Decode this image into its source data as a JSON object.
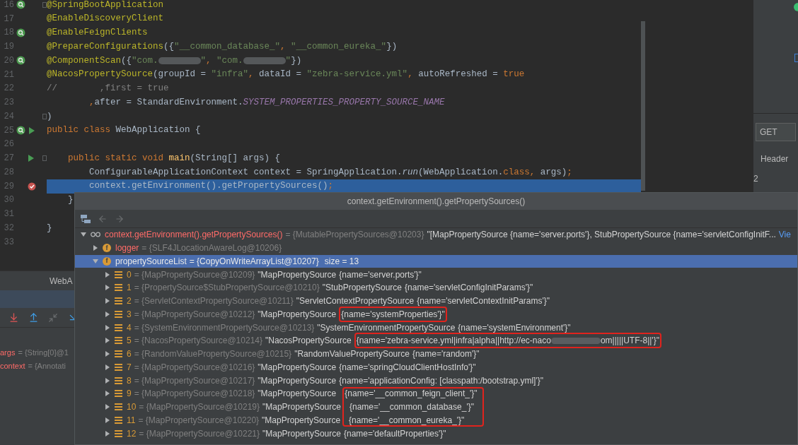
{
  "editor": {
    "lines": [
      {
        "number": "16",
        "kind": "bean",
        "fold": true,
        "selected": false,
        "tokens": [
          {
            "kind": "annotation",
            "text": "@SpringBootApplication"
          }
        ]
      },
      {
        "number": "17",
        "kind": "none",
        "fold": false,
        "selected": false,
        "tokens": [
          {
            "kind": "annotation",
            "text": "@EnableDiscoveryClient"
          }
        ]
      },
      {
        "number": "18",
        "kind": "bean",
        "fold": false,
        "selected": false,
        "tokens": [
          {
            "kind": "annotation",
            "text": "@EnableFeignClients"
          }
        ]
      },
      {
        "number": "19",
        "kind": "none",
        "fold": false,
        "selected": false,
        "tokens": [
          {
            "kind": "annotation",
            "text": "@PrepareConfigurations"
          },
          {
            "kind": "plain",
            "text": "({"
          },
          {
            "kind": "string",
            "text": "\"__common_database_\""
          },
          {
            "kind": "keyword",
            "text": ", "
          },
          {
            "kind": "string",
            "text": "\"__common_eureka_\""
          },
          {
            "kind": "plain",
            "text": "})"
          }
        ]
      },
      {
        "number": "20",
        "kind": "bean",
        "fold": false,
        "selected": false,
        "tokens": [
          {
            "kind": "annotation",
            "text": "@ComponentScan"
          },
          {
            "kind": "plain",
            "text": "({"
          },
          {
            "kind": "string",
            "text": "\"com."
          },
          {
            "kind": "redacted"
          },
          {
            "kind": "string",
            "text": "\""
          },
          {
            "kind": "keyword",
            "text": ", "
          },
          {
            "kind": "string",
            "text": "\"com."
          },
          {
            "kind": "redacted"
          },
          {
            "kind": "string",
            "text": "\""
          },
          {
            "kind": "plain",
            "text": "})"
          }
        ]
      },
      {
        "number": "21",
        "kind": "none",
        "fold": false,
        "selected": false,
        "tokens": [
          {
            "kind": "annotation",
            "text": "@NacosPropertySource"
          },
          {
            "kind": "plain",
            "text": "(groupId = "
          },
          {
            "kind": "string",
            "text": "\"infra\""
          },
          {
            "kind": "keyword",
            "text": ", "
          },
          {
            "kind": "plain",
            "text": "dataId = "
          },
          {
            "kind": "string",
            "text": "\"zebra-service.yml\""
          },
          {
            "kind": "keyword",
            "text": ", "
          },
          {
            "kind": "plain",
            "text": "autoRefreshed = "
          },
          {
            "kind": "keyword",
            "text": "true"
          }
        ]
      },
      {
        "number": "22",
        "kind": "none",
        "fold": false,
        "selected": false,
        "tokens": [
          {
            "kind": "comment",
            "text": "//        ,first = true"
          }
        ]
      },
      {
        "number": "23",
        "kind": "none",
        "fold": false,
        "selected": false,
        "tokens": [
          {
            "kind": "keyword",
            "text": "        ,"
          },
          {
            "kind": "plain",
            "text": "after = StandardEnvironment."
          },
          {
            "kind": "constant",
            "text": "SYSTEM_PROPERTIES_PROPERTY_SOURCE_NAME"
          }
        ]
      },
      {
        "number": "24",
        "kind": "none",
        "fold": true,
        "selected": false,
        "tokens": [
          {
            "kind": "plain",
            "text": ")"
          }
        ]
      },
      {
        "number": "25",
        "kind": "bean-run",
        "fold": false,
        "selected": false,
        "tokens": [
          {
            "kind": "keyword",
            "text": "public class "
          },
          {
            "kind": "plain",
            "text": "WebApplication {"
          }
        ]
      },
      {
        "number": "26",
        "kind": "none",
        "fold": false,
        "selected": false
      },
      {
        "number": "27",
        "kind": "run",
        "fold": true,
        "selected": false,
        "tokens": [
          {
            "kind": "keyword",
            "text": "    public static void "
          },
          {
            "kind": "method",
            "text": "main"
          },
          {
            "kind": "plain",
            "text": "(String[] args) {"
          }
        ]
      },
      {
        "number": "28",
        "kind": "none",
        "fold": false,
        "selected": false,
        "tokens": [
          {
            "kind": "plain",
            "text": "        ConfigurableApplicationContext context = SpringApplication."
          },
          {
            "kind": "italic",
            "text": "run"
          },
          {
            "kind": "plain",
            "text": "(WebApplication."
          },
          {
            "kind": "keyword",
            "text": "class, "
          },
          {
            "kind": "plain",
            "text": "args)"
          },
          {
            "kind": "keyword",
            "text": ";"
          }
        ]
      },
      {
        "number": "29",
        "kind": "breakpoint",
        "fold": false,
        "selected": true,
        "tokens": [
          {
            "kind": "plain",
            "text": "        context.getEnvironment().getPropertySources()"
          },
          {
            "kind": "keyword",
            "text": ";"
          }
        ]
      },
      {
        "number": "30",
        "kind": "none",
        "fold": false,
        "selected": false,
        "tokens": [
          {
            "kind": "plain",
            "text": "    }"
          }
        ]
      },
      {
        "number": "31",
        "kind": "none",
        "fold": false,
        "selected": false
      },
      {
        "number": "32",
        "kind": "none",
        "fold": false,
        "selected": false,
        "tokens": [
          {
            "kind": "plain",
            "text": "}"
          }
        ]
      },
      {
        "number": "33",
        "kind": "none",
        "fold": false,
        "selected": false
      }
    ]
  },
  "debug_panel": {
    "tab": "WebA",
    "variables": [
      {
        "name": "args",
        "value": "= {String[0]@1"
      },
      {
        "name": "context",
        "value": "= {Annotati"
      }
    ]
  },
  "side_panel": {
    "method": "GET",
    "tab": "Header",
    "row": "2"
  },
  "popup": {
    "title": "context.getEnvironment().getPropertySources()",
    "root": {
      "name": "context.getEnvironment().getPropertySources()",
      "ref": "= {MutablePropertySources@10203}",
      "value": "\"[MapPropertySource {name='server.ports'}, StubPropertySource {name='servletConfigInitF...",
      "link": "Vie",
      "expanded": true,
      "selected": false,
      "children": [
        {
          "kind": "field",
          "badge": "f",
          "name": "logger",
          "ref": "= {SLF4JLocationAwareLog@10206}",
          "expanded": false,
          "selected": false
        },
        {
          "kind": "field",
          "badge": "f",
          "name": "propertySourceList",
          "ref": "= {CopyOnWriteArrayList@10207}",
          "size": "size = 13",
          "expanded": true,
          "selected": true,
          "children": [
            {
              "kind": "element",
              "index": "0",
              "ref": "= {MapPropertySource@10209}",
              "value_class": "\"MapPropertySource",
              "value_name": "{name='server.ports'}\"",
              "highlighted": false,
              "expanded": false,
              "selected": false
            },
            {
              "kind": "element",
              "index": "1",
              "ref": "= {PropertySource$StubPropertySource@10210}",
              "value_class": "\"StubPropertySource",
              "value_name": "{name='servletConfigInitParams'}\"",
              "highlighted": false,
              "expanded": false,
              "selected": false
            },
            {
              "kind": "element",
              "index": "2",
              "ref": "= {ServletContextPropertySource@10211}",
              "value_class": "\"ServletContextPropertySource",
              "value_name": "{name='servletContextInitParams'}\"",
              "highlighted": false,
              "expanded": false,
              "selected": false
            },
            {
              "kind": "element",
              "index": "3",
              "ref": "= {MapPropertySource@10212}",
              "value_class": "\"MapPropertySource",
              "value_name": "{name='systemProperties'}\"",
              "highlighted": true,
              "expanded": false,
              "selected": false
            },
            {
              "kind": "element",
              "index": "4",
              "ref": "= {SystemEnvironmentPropertySource@10213}",
              "value_class": "\"SystemEnvironmentPropertySource",
              "value_name": "{name='systemEnvironment'}\"",
              "highlighted": false,
              "expanded": false,
              "selected": false
            },
            {
              "kind": "element",
              "index": "5",
              "ref": "= {NacosPropertySource@10214}",
              "value_class": "\"NacosPropertySource",
              "value_name": "{name='zebra-service.yml|infra|alpha||http://ec-naco",
              "redacted": true,
              "value_tail": "om|||||UTF-8||'}\"",
              "highlighted": true,
              "expanded": false,
              "selected": false
            },
            {
              "kind": "element",
              "index": "6",
              "ref": "= {RandomValuePropertySource@10215}",
              "value_class": "\"RandomValuePropertySource",
              "value_name": "{name='random'}\"",
              "highlighted": false,
              "expanded": false,
              "selected": false
            },
            {
              "kind": "element",
              "index": "7",
              "ref": "= {MapPropertySource@10216}",
              "value_class": "\"MapPropertySource",
              "value_name": "{name='springCloudClientHostInfo'}\"",
              "highlighted": false,
              "expanded": false,
              "selected": false
            },
            {
              "kind": "element",
              "index": "8",
              "ref": "= {MapPropertySource@10217}",
              "value_class": "\"MapPropertySource",
              "value_name": "{name='applicationConfig: [classpath:/bootstrap.yml]'}\"",
              "highlighted": false,
              "expanded": false,
              "selected": false
            },
            {
              "kind": "element",
              "index": "9",
              "ref": "= {MapPropertySource@10218}",
              "value_class": "\"MapPropertySource",
              "value_name": "{name='__common_feign_client_'}\"",
              "highlighted": true,
              "expanded": false,
              "selected": false
            },
            {
              "kind": "element",
              "index": "10",
              "ref": "= {MapPropertySource@10219}",
              "value_class": "\"MapPropertySource",
              "value_name": "{name='__common_database_'}\"",
              "highlighted": true,
              "expanded": false,
              "selected": false
            },
            {
              "kind": "element",
              "index": "11",
              "ref": "= {MapPropertySource@10220}",
              "value_class": "\"MapPropertySource",
              "value_name": "{name='__common_eureka_'}\"",
              "highlighted": true,
              "expanded": false,
              "selected": false
            },
            {
              "kind": "element",
              "index": "12",
              "ref": "= {MapPropertySource@10221}",
              "value_class": "\"MapPropertySource",
              "value_name": "{name='defaultProperties'}\"",
              "highlighted": false,
              "expanded": false,
              "selected": false
            }
          ]
        }
      ]
    }
  }
}
